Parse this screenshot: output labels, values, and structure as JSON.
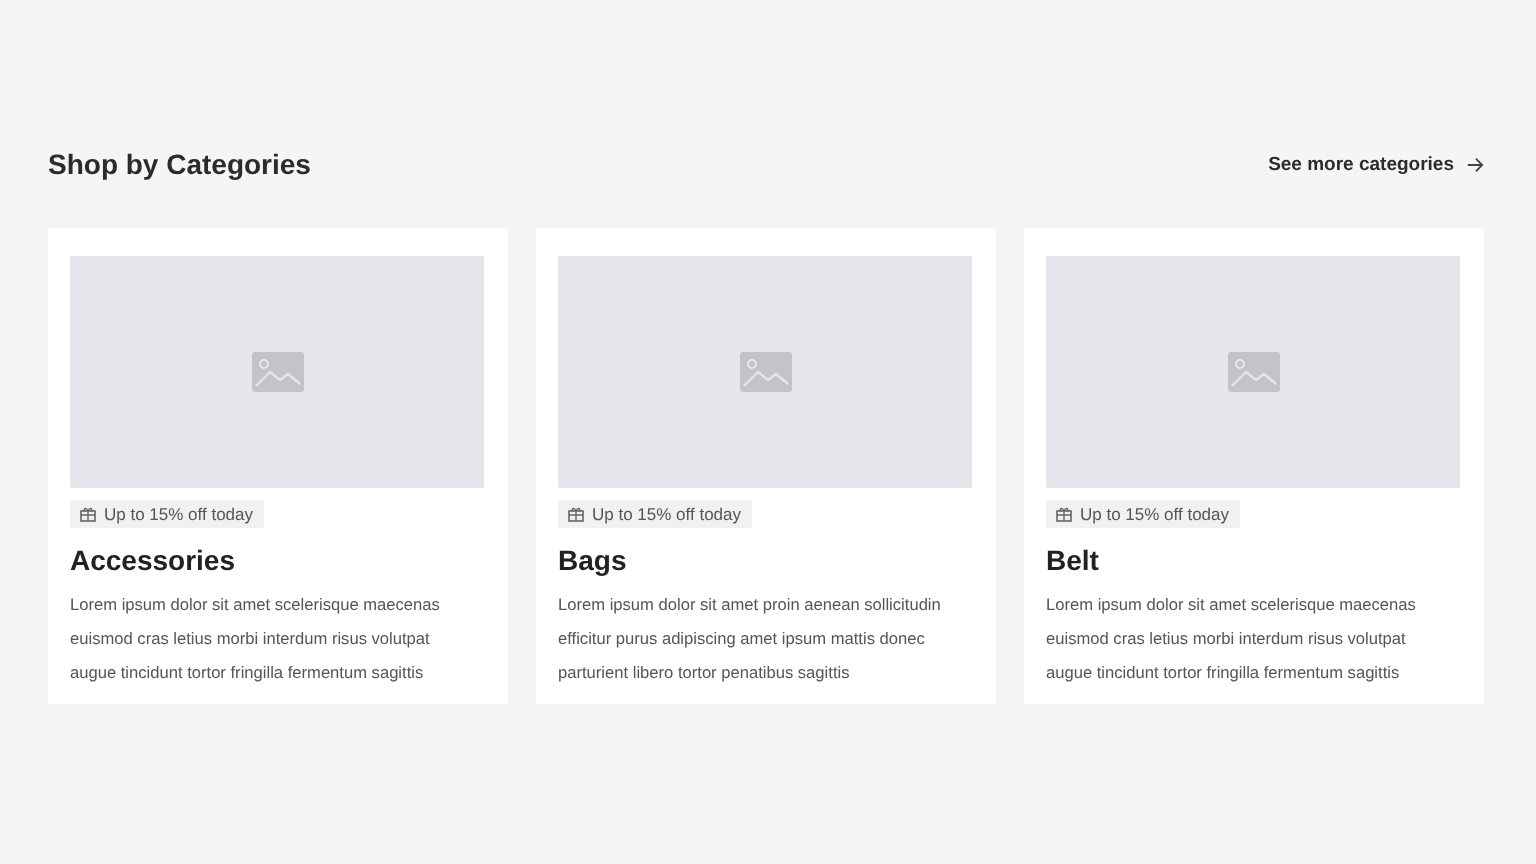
{
  "section": {
    "title": "Shop by Categories",
    "link": "See more categories"
  },
  "categories": [
    {
      "badge": "Up to 15% off today",
      "name": "Accessories",
      "description": "Lorem ipsum dolor sit amet scelerisque maecenas\neuismod cras letius morbi interdum risus volutpat\naugue tincidunt tortor fringilla fermentum sagittis"
    },
    {
      "badge": "Up to 15% off today",
      "name": "Bags",
      "description": "Lorem ipsum dolor sit amet proin aenean sollicitudin\nefficitur purus adipiscing amet ipsum mattis donec\nparturient libero tortor penatibus sagittis"
    },
    {
      "badge": "Up to 15% off today",
      "name": "Belt",
      "description": "Lorem ipsum dolor sit amet scelerisque maecenas\neuismod cras letius morbi interdum risus volutpat\naugue tincidunt tortor fringilla fermentum sagittis"
    }
  ]
}
